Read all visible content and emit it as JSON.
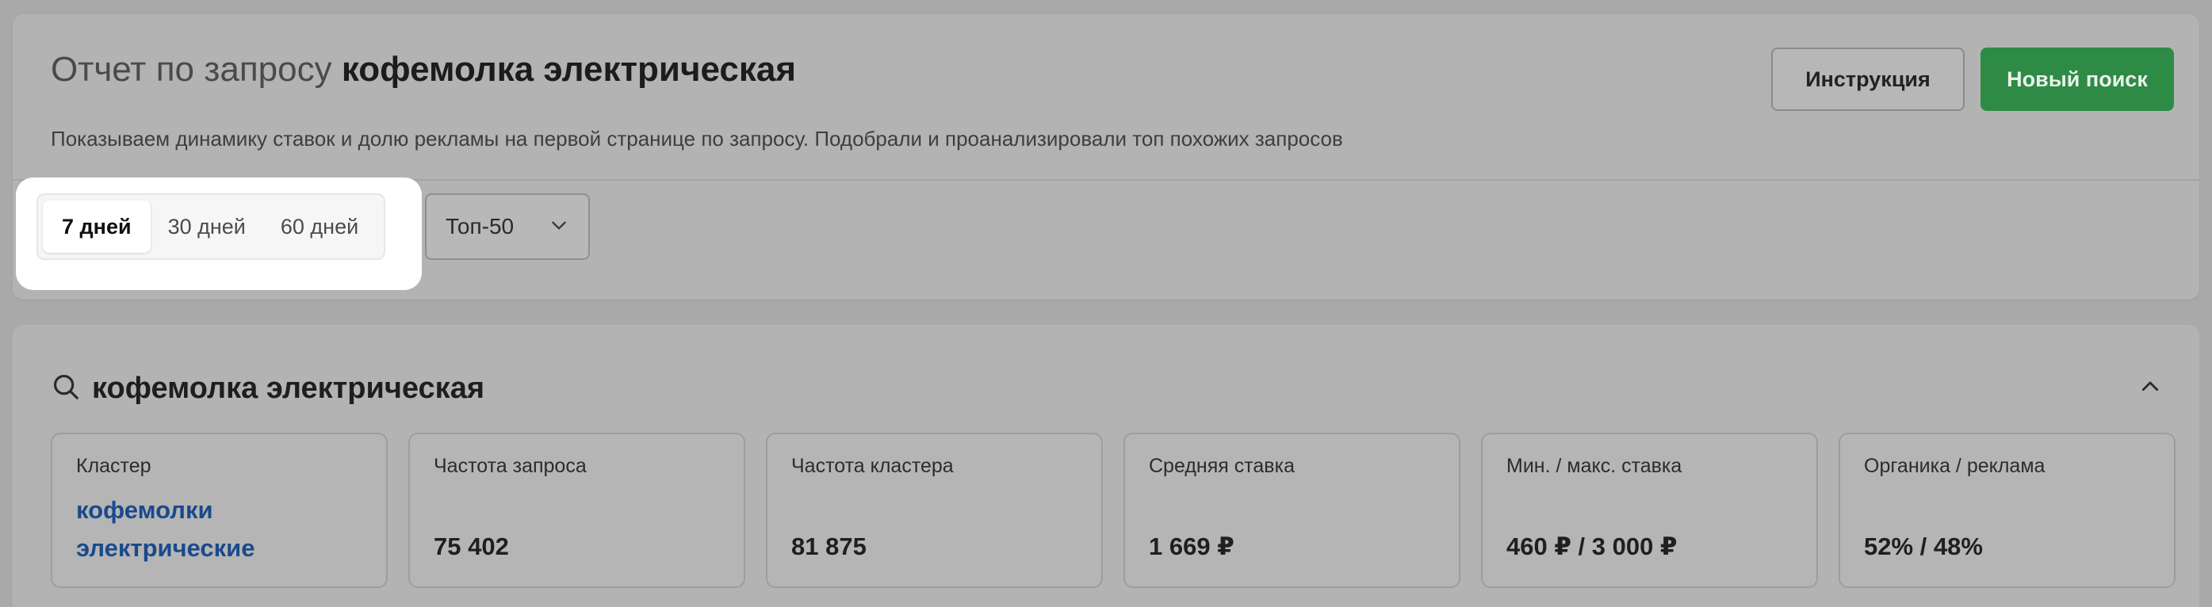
{
  "header": {
    "title_prefix": "Отчет по запросу",
    "title_query": "кофемолка электрическая",
    "subtitle": "Показываем динамику ставок и долю рекламы на первой странице по запросу. Подобрали и проанализировали топ похожих запросов",
    "instruction_label": "Инструкция",
    "new_search_label": "Новый поиск",
    "new_search_color": "#2e8b45"
  },
  "filters": {
    "periods": [
      "7 дней",
      "30 дней",
      "60 дней"
    ],
    "active_period": "7 дней",
    "top_select_value": "Топ-50",
    "top_select_icon": "chevron-down-icon"
  },
  "query_card": {
    "name": "кофемолка электрическая",
    "search_icon": "search-icon",
    "collapse_icon": "chevron-up-icon",
    "metrics": {
      "cluster_label": "Кластер",
      "cluster_value_line1": "кофемолки",
      "cluster_value_line2": "электрические",
      "query_freq_label": "Частота запроса",
      "query_freq_value": "75 402",
      "cluster_freq_label": "Частота кластера",
      "cluster_freq_value": "81 875",
      "avg_bid_label": "Средняя ставка",
      "avg_bid_value": "1 669 ₽",
      "min_max_bid_label": "Мин. / макс. ставка",
      "min_max_bid_value": "460 ₽ / 3 000 ₽",
      "organic_ads_label": "Органика / реклама",
      "organic_ads_value": "52% / 48%"
    }
  }
}
